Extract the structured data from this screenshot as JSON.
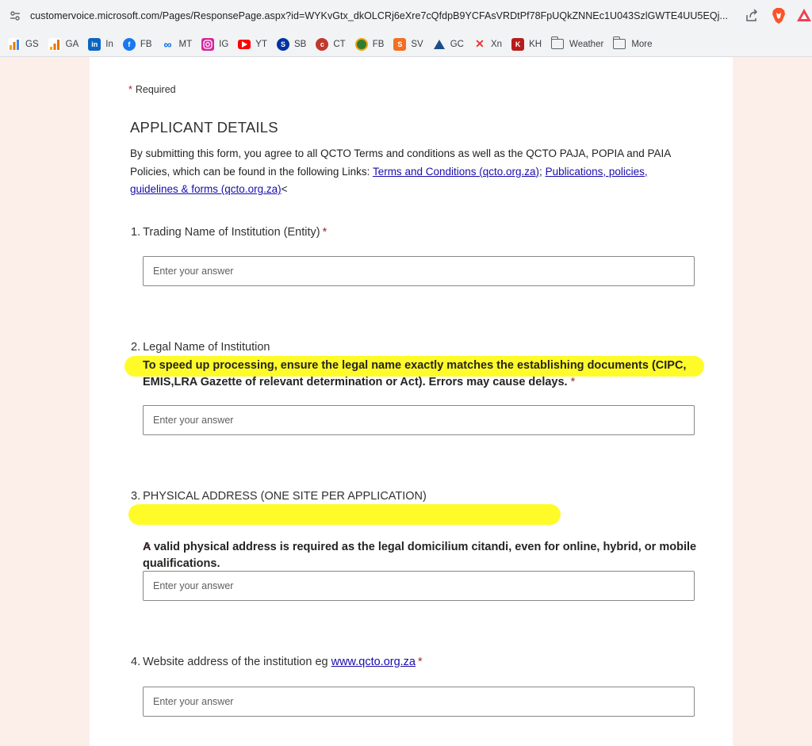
{
  "browser": {
    "url": "customervoice.microsoft.com/Pages/ResponsePage.aspx?id=WYKvGtx_dkOLCRj6eXre7cQfdpB9YCFAsVRDtPf78FpUQkZNNEc1U043SzlGWTE4UU5EQj...",
    "bookmarks": [
      {
        "label": "GS",
        "icon": "bar-chart-icon",
        "color": "#f4a100"
      },
      {
        "label": "GA",
        "icon": "analytics-icon",
        "color": "#e37400"
      },
      {
        "label": "In",
        "icon": "linkedin-icon",
        "color": "#0a66c2"
      },
      {
        "label": "FB",
        "icon": "facebook-icon",
        "color": "#1877f2"
      },
      {
        "label": "MT",
        "icon": "meta-icon",
        "color": "#0668e1"
      },
      {
        "label": "IG",
        "icon": "instagram-icon",
        "color": "#d6249f"
      },
      {
        "label": "YT",
        "icon": "youtube-icon",
        "color": "#ff0000"
      },
      {
        "label": "SB",
        "icon": "shield-icon",
        "color": "#0033a1"
      },
      {
        "label": "CT",
        "icon": "ct-icon",
        "color": "#c0392b"
      },
      {
        "label": "FB",
        "icon": "circle-logo-icon",
        "color": "#2e7d32"
      },
      {
        "label": "SV",
        "icon": "sv-icon",
        "color": "#f36f21"
      },
      {
        "label": "GC",
        "icon": "triangle-icon",
        "color": "#1c4f8a"
      },
      {
        "label": "Xn",
        "icon": "butterfly-icon",
        "color": "#e53935"
      },
      {
        "label": "KH",
        "icon": "kh-icon",
        "color": "#b71c1c"
      },
      {
        "label": "Weather",
        "icon": "folder-icon",
        "color": "#5f6368"
      },
      {
        "label": "More",
        "icon": "folder-icon",
        "color": "#5f6368"
      }
    ]
  },
  "form": {
    "required_star": "*",
    "required_note": "Required",
    "section_title": "APPLICANT DETAILS",
    "section_desc_text": "By submitting this form, you agree to all QCTO Terms and conditions as well as the QCTO PAJA, POPIA and PAIA Policies, which can be found in the following Links: ",
    "link_terms": "Terms and Conditions (qcto.org.za)",
    "sep": ";",
    "link_publications": "Publications, policies, guidelines & forms (qcto.org.za)",
    "desc_tail": "<",
    "placeholder": "Enter your answer",
    "questions": [
      {
        "num": "1.",
        "title": "Trading Name of Institution (Entity)"
      },
      {
        "num": "2.",
        "title": "Legal Name of Institution",
        "sub": "To speed up processing, ensure the legal name exactly matches the establishing documents (CIPC, EMIS,LRA Gazette of relevant determination or Act). Errors may cause delays."
      },
      {
        "num": "3.",
        "title": "PHYSICAL ADDRESS (ONE SITE PER APPLICATION)",
        "sub": "A valid physical address is required as the legal domicilium citandi, even for online, hybrid, or mobile qualifications."
      },
      {
        "num": "4.",
        "title": "Website address of the institution eg ",
        "link": "www.qcto.org.za"
      }
    ]
  },
  "colors": {
    "accent_required": "#a4262c",
    "highlight": "#fffb17",
    "page_background": "#fcefe9",
    "link": "#1a0dab"
  }
}
